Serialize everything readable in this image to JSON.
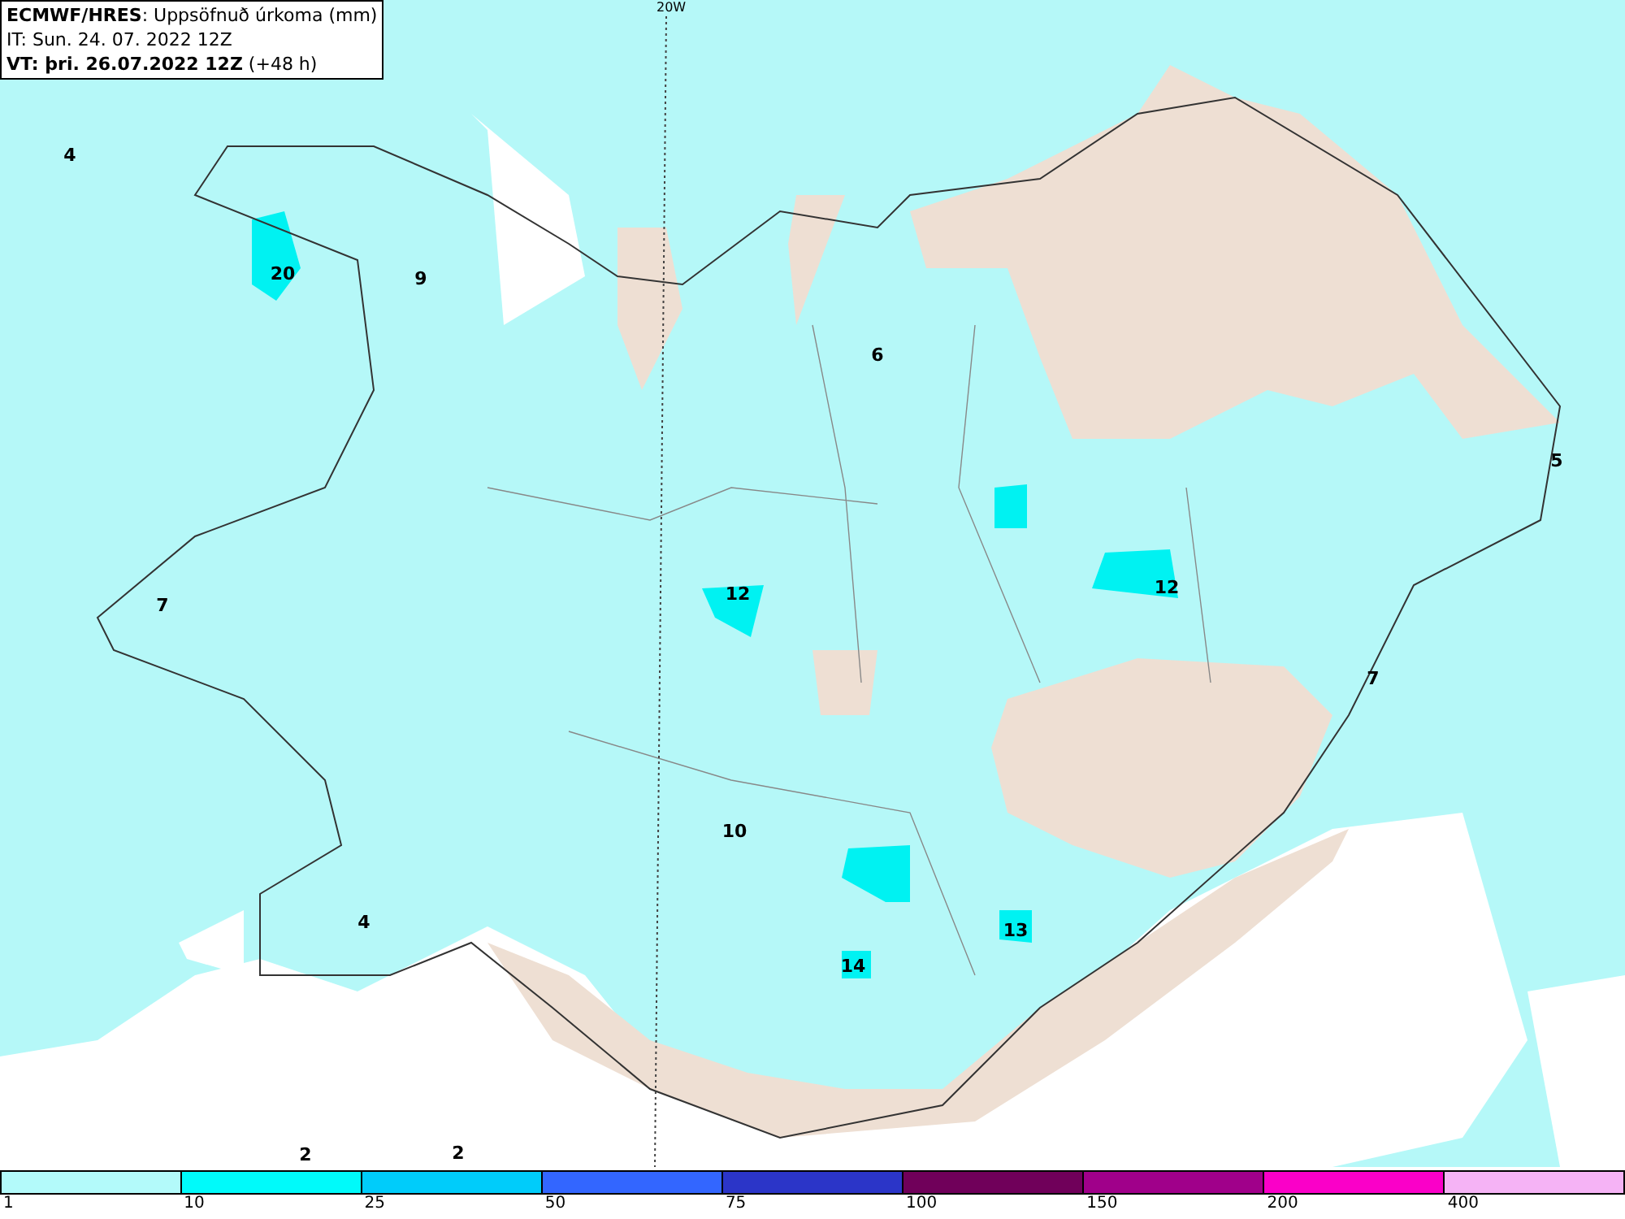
{
  "header": {
    "lines": [
      "**ECMWF/HRES**: Uppsöfnuð úrkoma (mm)",
      "IT: Sun. 24. 07. 2022 12Z",
      "**VT: þri. 26.07.2022 12Z** (+48 h)"
    ]
  },
  "map": {
    "meridian_label": "20W",
    "value_labels": [
      "4",
      "20",
      "9",
      "6",
      "5",
      "7",
      "12",
      "12",
      "7",
      "10",
      "4",
      "13",
      "14",
      "2",
      "2"
    ]
  },
  "legend": {
    "segments": [
      {
        "color": "#b3fafa"
      },
      {
        "color": "#00fafa"
      },
      {
        "color": "#00ccfa"
      },
      {
        "color": "#3366ff"
      },
      {
        "color": "#2b35c8"
      },
      {
        "color": "#70005a"
      },
      {
        "color": "#a0008a"
      },
      {
        "color": "#fa00c8"
      },
      {
        "color": "#f5b3f5"
      }
    ],
    "ticks": [
      "1",
      "10",
      "25",
      "50",
      "75",
      "100",
      "150",
      "200",
      "400"
    ]
  }
}
